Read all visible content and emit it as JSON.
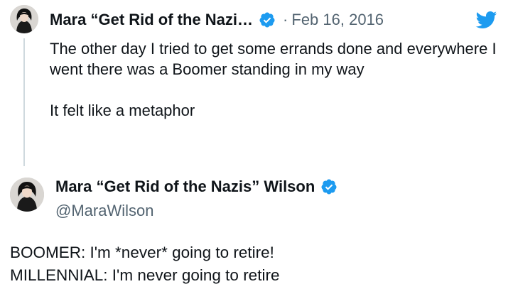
{
  "parent_tweet": {
    "author_name": "Mara “Get Rid of the Nazi…",
    "separator": "·",
    "date": "Feb 16, 2016",
    "text_lines": [
      "The other day I tried to get some errands done and everywhere I went there was a Boomer standing in my way",
      "It felt like a metaphor"
    ]
  },
  "main_tweet": {
    "author_name": "Mara “Get Rid of the Nazis” Wilson",
    "handle": "@MaraWilson",
    "text_lines": [
      "BOOMER: I'm *never* going to retire!",
      "MILLENNIAL: I'm never going to retire"
    ]
  },
  "icons": {
    "verified": "verified-badge-icon",
    "logo": "twitter-bird-icon",
    "avatar": "user-avatar"
  },
  "colors": {
    "text": "#0f1419",
    "secondary_text": "#536471",
    "accent": "#1d9bf0",
    "thread_line": "#cfd9de"
  }
}
